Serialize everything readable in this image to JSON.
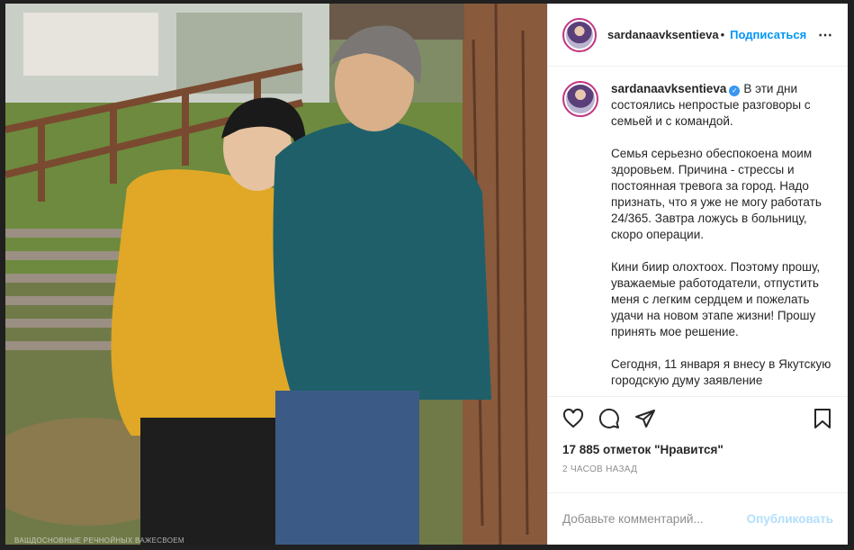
{
  "post": {
    "photo_overlay_text": "ВАШДОСНОВНЫЕ РЕЧНОЙНЫХ ВАЖЕСВОЕМ",
    "colors": {
      "link": "#0095f6",
      "verified": "#3897f0",
      "publish_disabled": "#b2dffc",
      "ring": "#c13584"
    }
  },
  "header": {
    "username": "sardanaavksentieva",
    "separator": "•",
    "follow_label": "Подписаться",
    "more_icon": "⋯"
  },
  "caption": {
    "username": "sardanaavksentieva",
    "verified_icon": "✓",
    "paragraphs": [
      "В эти дни состоялись непростые разговоры с семьей и с командой.",
      "Семья серьезно обеспокоена моим здоровьем. Причина - стрессы и постоянная тревога за город. Надо признать, что я уже не могу работать 24/365. Завтра ложусь в больницу, скоро операции.",
      "Кини биир олохтоох. Поэтому прошу, уважаемые работодатели, отпустить меня с легким сердцем и пожелать удачи на новом этапе жизни! Прошу принять мое решение.",
      "Сегодня, 11 января я внесу в Якутскую городскую думу заявление"
    ]
  },
  "actions": {
    "icons": [
      "heart-icon",
      "comment-icon",
      "share-icon",
      "bookmark-icon"
    ]
  },
  "likes_text": "17 885 отметок \"Нравится\"",
  "timestamp": "2 ЧАСОВ НАЗАД",
  "comment": {
    "placeholder": "Добавьте комментарий...",
    "publish_label": "Опубликовать"
  }
}
